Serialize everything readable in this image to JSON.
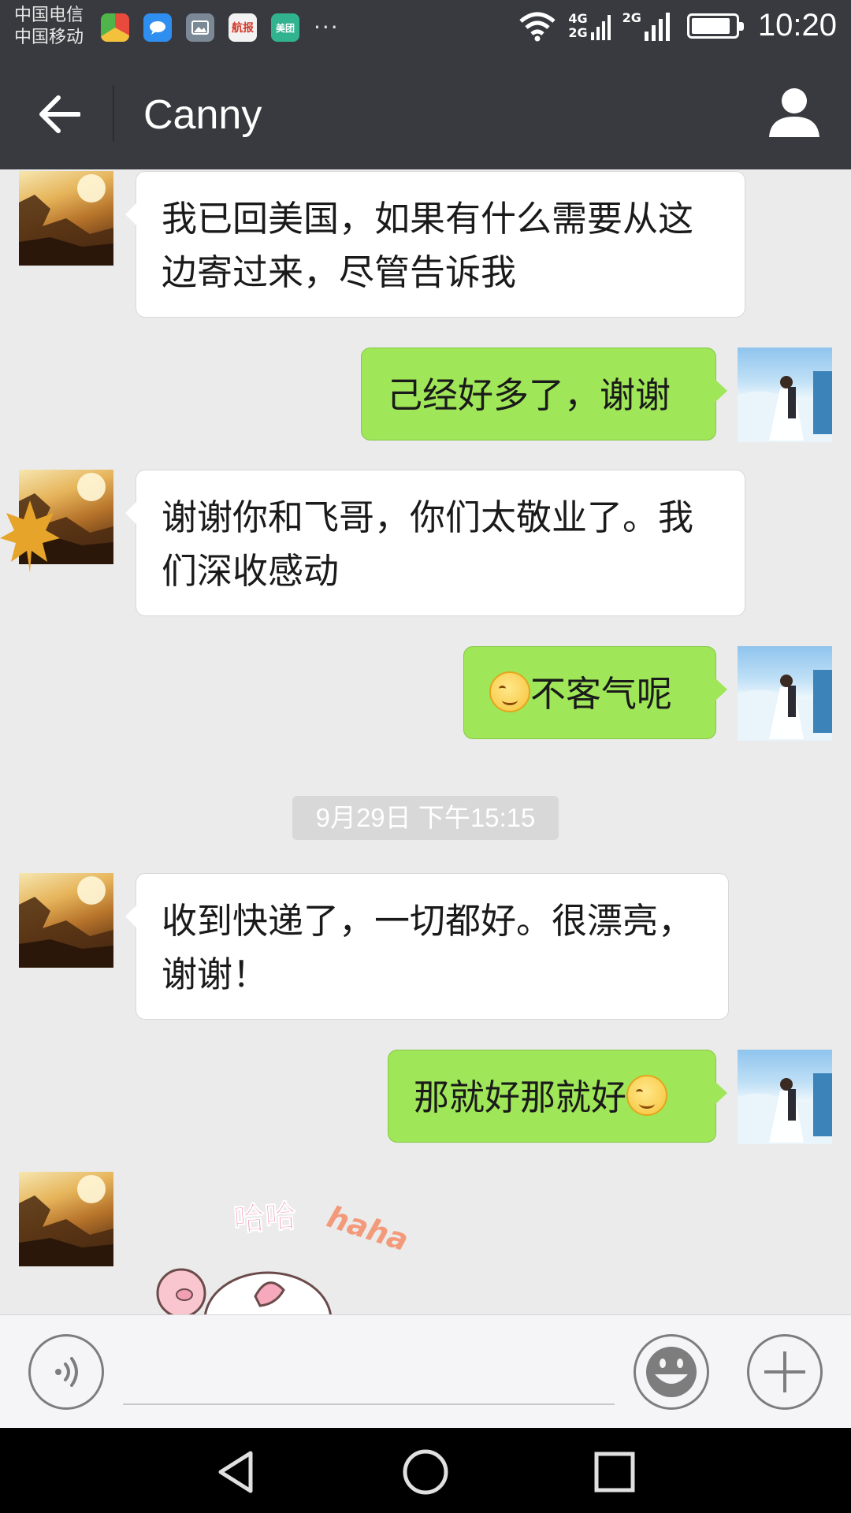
{
  "status_bar": {
    "carrier_1": "中国电信",
    "carrier_2": "中国移动",
    "app_icons": [
      "browser-icon",
      "message-icon",
      "gallery-icon",
      "news-icon",
      "meituan-icon"
    ],
    "news_icon_label": "航报",
    "meituan_icon_label": "美团",
    "more": "···",
    "net_4g": "4G",
    "net_2g_a": "2G",
    "net_2g_b": "2G",
    "battery_level": 0.9,
    "time": "10:20"
  },
  "header": {
    "title": "Canny",
    "back_icon": "back-arrow-icon",
    "profile_icon": "person-icon"
  },
  "messages": [
    {
      "side": "left",
      "text": "我已回美国，如果有什么需要从这边寄过来，尽管告诉我"
    },
    {
      "side": "right",
      "text": "己经好多了，谢谢"
    },
    {
      "side": "left",
      "text": "谢谢你和飞哥，你们太敬业了。我们深收感动"
    },
    {
      "side": "right",
      "text": "不客气呢",
      "emoji": "smile-emoji"
    },
    {
      "side": "left",
      "text": "收到快递了，一切都好。很漂亮，谢谢！"
    },
    {
      "side": "right",
      "text": "那就好那就好",
      "emoji": "smile-emoji"
    }
  ],
  "timestamp": "9月29日 下午15:15",
  "sticker": {
    "text_1": "哈哈",
    "text_2": "haha"
  },
  "input_bar": {
    "voice_icon": "voice-icon",
    "emoji_icon": "emoji-icon",
    "plus_icon": "plus-icon",
    "input_value": ""
  },
  "nav_bar": {
    "back": "nav-back-icon",
    "home": "nav-home-icon",
    "recent": "nav-recent-icon"
  }
}
